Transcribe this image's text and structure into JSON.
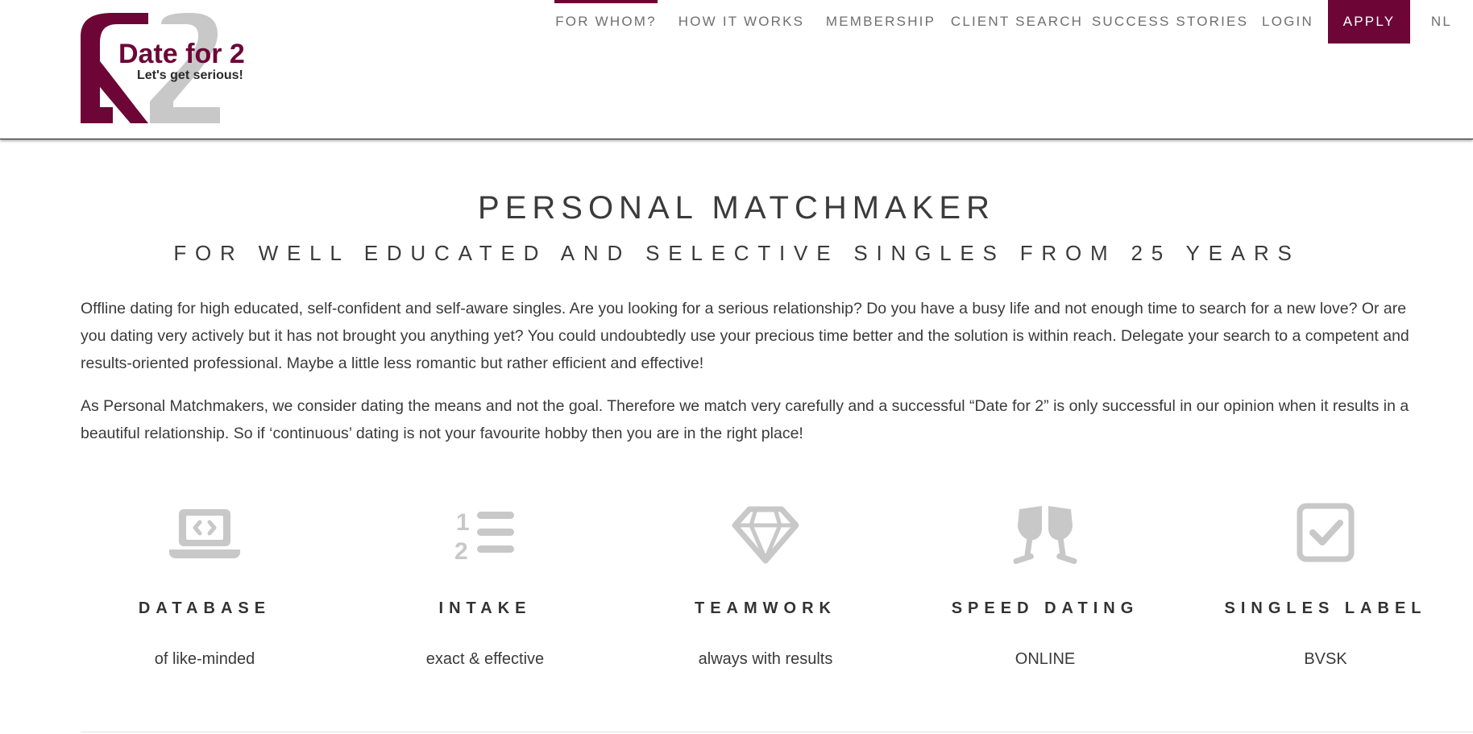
{
  "brand": {
    "name": "Date for 2",
    "tagline": "Let's get serious!",
    "primary_color": "#6d0637",
    "secondary_color": "#c8c8c8"
  },
  "nav": {
    "items": [
      {
        "label": "FOR WHOM?",
        "active": true
      },
      {
        "label": "HOW IT WORKS"
      },
      {
        "label": "MEMBERSHIP"
      },
      {
        "label": "CLIENT SEARCH"
      },
      {
        "label": "SUCCESS STORIES"
      },
      {
        "label": "LOGIN"
      },
      {
        "label": "APPLY",
        "highlight": true
      },
      {
        "label": "NL"
      }
    ]
  },
  "hero": {
    "title": "PERSONAL MATCHMAKER",
    "subtitle": "FOR WELL EDUCATED AND SELECTIVE SINGLES FROM 25 YEARS"
  },
  "intro": {
    "p1": "Offline dating for high educated, self-confident and self-aware singles. Are you looking for a serious relationship? Do you have a busy life and not enough time to search for a new love? Or are you dating very actively but it has not brought you anything yet? You could undoubtedly use your precious time better and the solution is within reach. Delegate your search to a competent and results-oriented professional. Maybe a little less romantic but rather efficient and effective!",
    "p2": "As Personal Matchmakers, we consider dating the means and not the goal. Therefore we match very carefully and a successful “Date for 2” is only successful in our opinion when it results in a beautiful relationship. So if ‘continuous’ dating is not your favourite hobby then you are in the right place!"
  },
  "features": [
    {
      "icon": "laptop-code-icon",
      "title": "DATABASE",
      "subtitle": "of like-minded"
    },
    {
      "icon": "numbered-list-icon",
      "title": "INTAKE",
      "subtitle": "exact & effective"
    },
    {
      "icon": "diamond-icon",
      "title": "TEAMWORK",
      "subtitle": "always with results"
    },
    {
      "icon": "glasses-cheers-icon",
      "title": "SPEED DATING",
      "subtitle": "ONLINE"
    },
    {
      "icon": "checkbox-icon",
      "title": "SINGLES LABEL",
      "subtitle": "BVSK"
    }
  ]
}
